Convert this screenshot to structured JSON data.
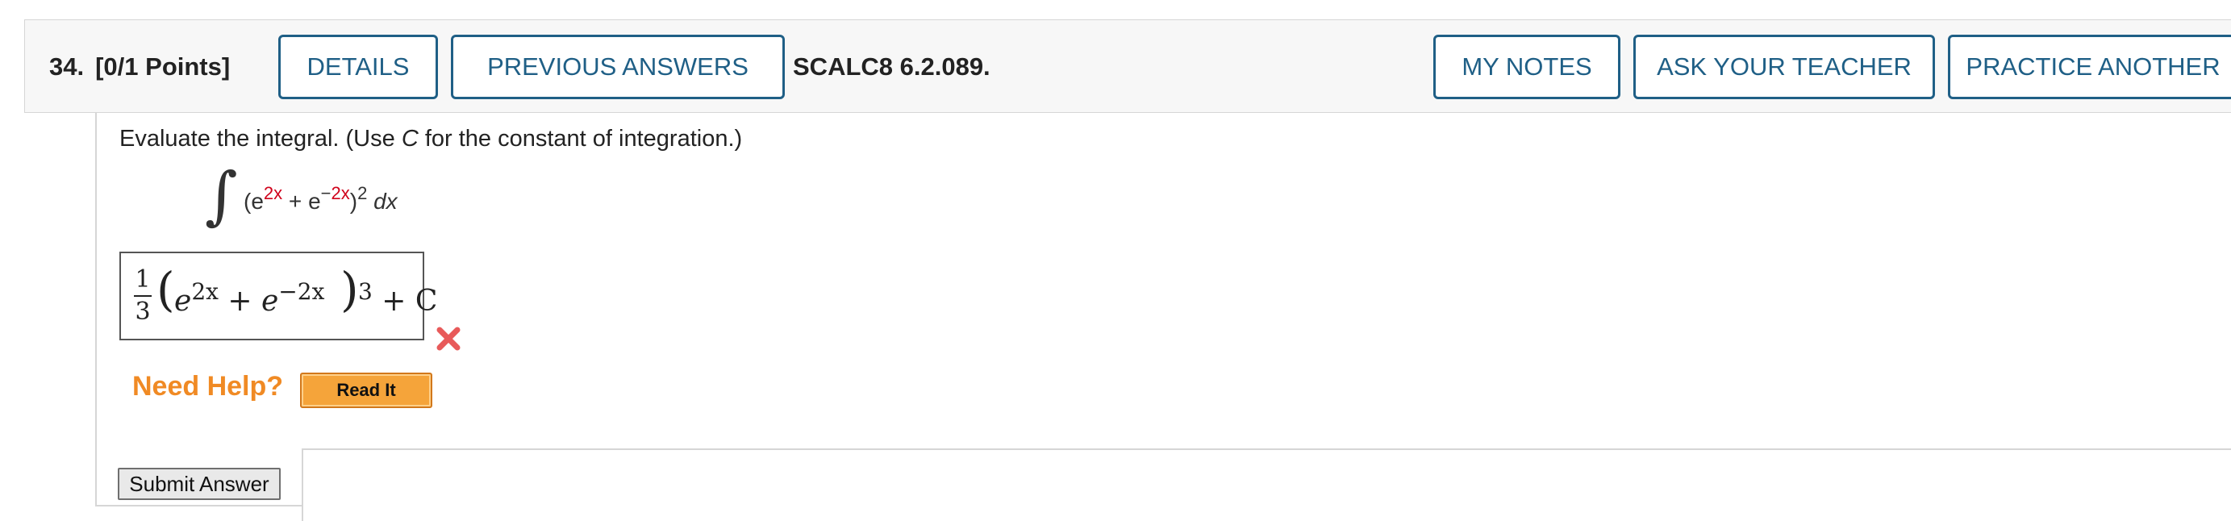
{
  "question": {
    "number": "34.",
    "points": "[0/1 Points]",
    "reference": "SCALC8 6.2.089."
  },
  "header_buttons": {
    "details": "DETAILS",
    "previous_answers": "PREVIOUS ANSWERS",
    "my_notes": "MY NOTES",
    "ask_teacher": "ASK YOUR TEACHER",
    "practice_another": "PRACTICE ANOTHER"
  },
  "instruction": {
    "prefix": "Evaluate the integral. (Use ",
    "var": "C",
    "suffix": " for the constant of integration.)"
  },
  "integral": {
    "sign": "∫",
    "open": "(e",
    "exp1": "2x",
    "plus": " + e",
    "exp2_minus": "−",
    "exp2": "2x",
    "close": ")",
    "power": "2",
    "dx": " dx"
  },
  "answer": {
    "frac_num": "1",
    "frac_den": "3",
    "open_paren": "(",
    "e1": "e",
    "exp1": "2x",
    "plus": " + ",
    "e2": "e",
    "exp2": "−2x",
    "close_paren": ")",
    "power": "3",
    "constant": " + C"
  },
  "status": {
    "icon": "red-x-icon",
    "color": "#e85a5a"
  },
  "help": {
    "label": "Need Help?",
    "read_it": "Read It"
  },
  "submit": {
    "label": "Submit Answer"
  },
  "colors": {
    "button_border": "#1f5f86",
    "help_orange": "#f08a24",
    "exponent_red": "#d0021b"
  }
}
